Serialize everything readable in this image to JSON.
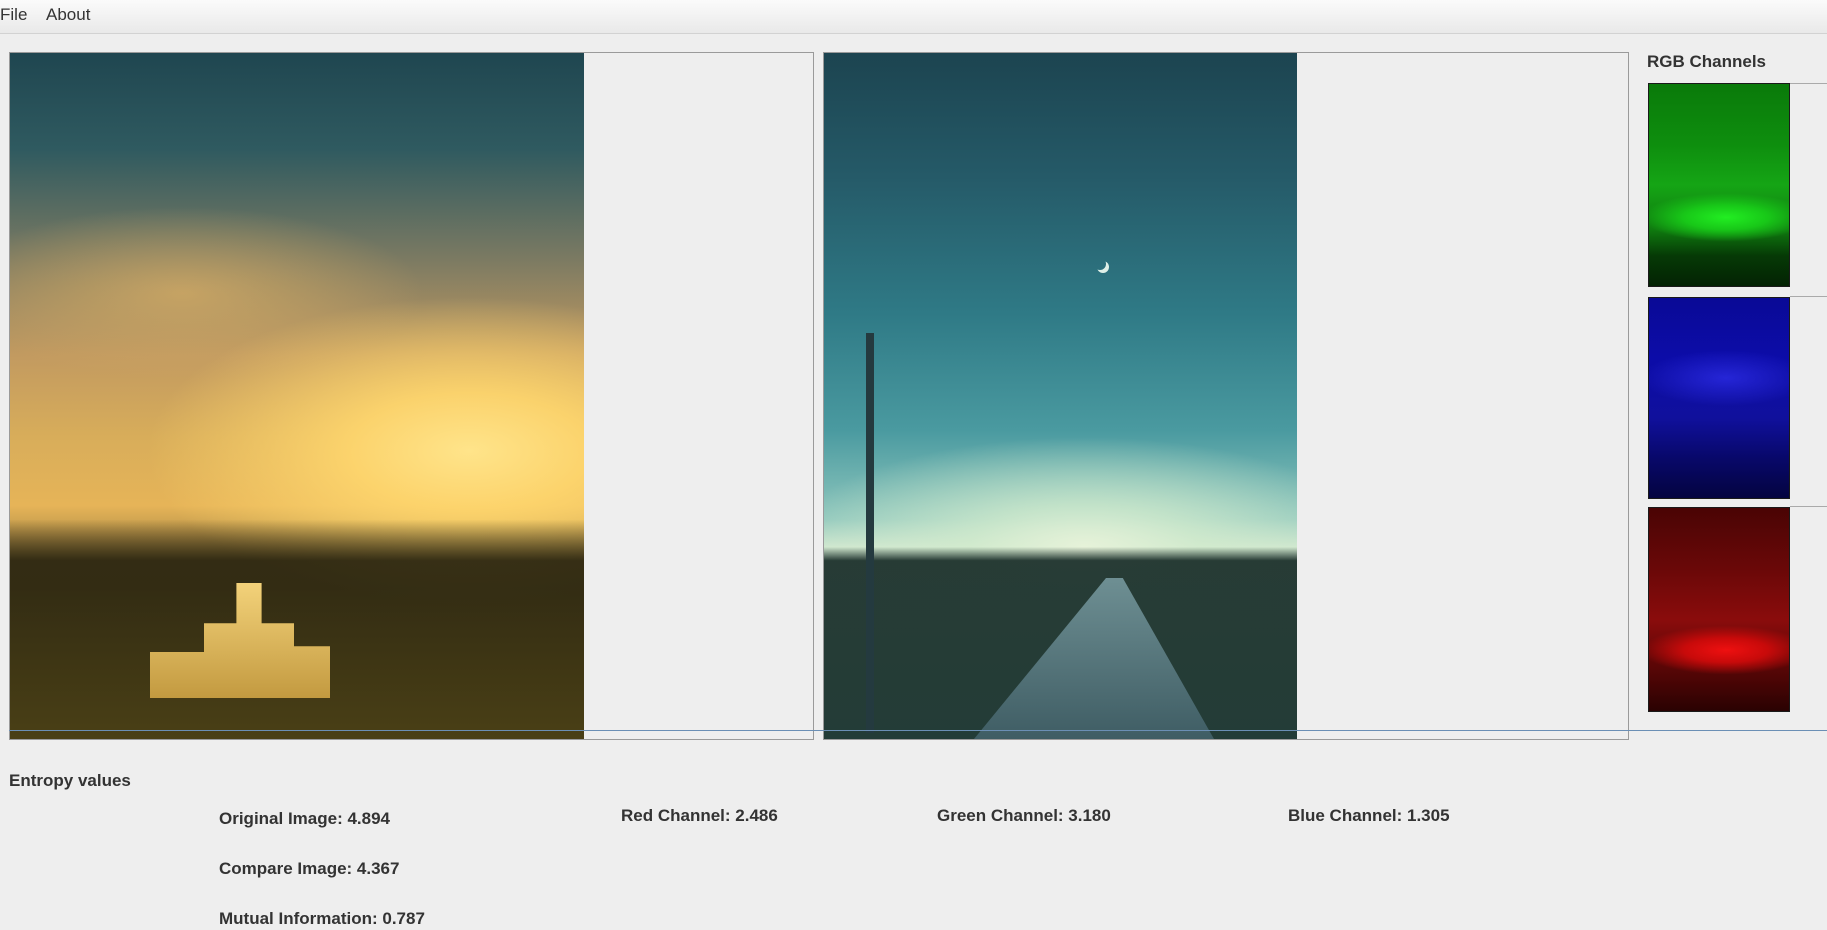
{
  "menu": {
    "file": "File",
    "about": "About"
  },
  "images": {
    "original": "original-image",
    "compare": "compare-image"
  },
  "rgb_channels": {
    "title": "RGB Channels",
    "channels": [
      {
        "name": "green-channel",
        "color": "#15a515"
      },
      {
        "name": "blue-channel",
        "color": "#0c0ca8"
      },
      {
        "name": "red-channel",
        "color": "#c80a0a"
      }
    ]
  },
  "entropy": {
    "title": "Entropy values",
    "original": "Original Image: 4.894",
    "compare": "Compare Image: 4.367",
    "mutual": "Mutual Information: 0.787",
    "red": "Red Channel: 2.486",
    "green": "Green Channel: 3.180",
    "blue": "Blue Channel: 1.305"
  }
}
